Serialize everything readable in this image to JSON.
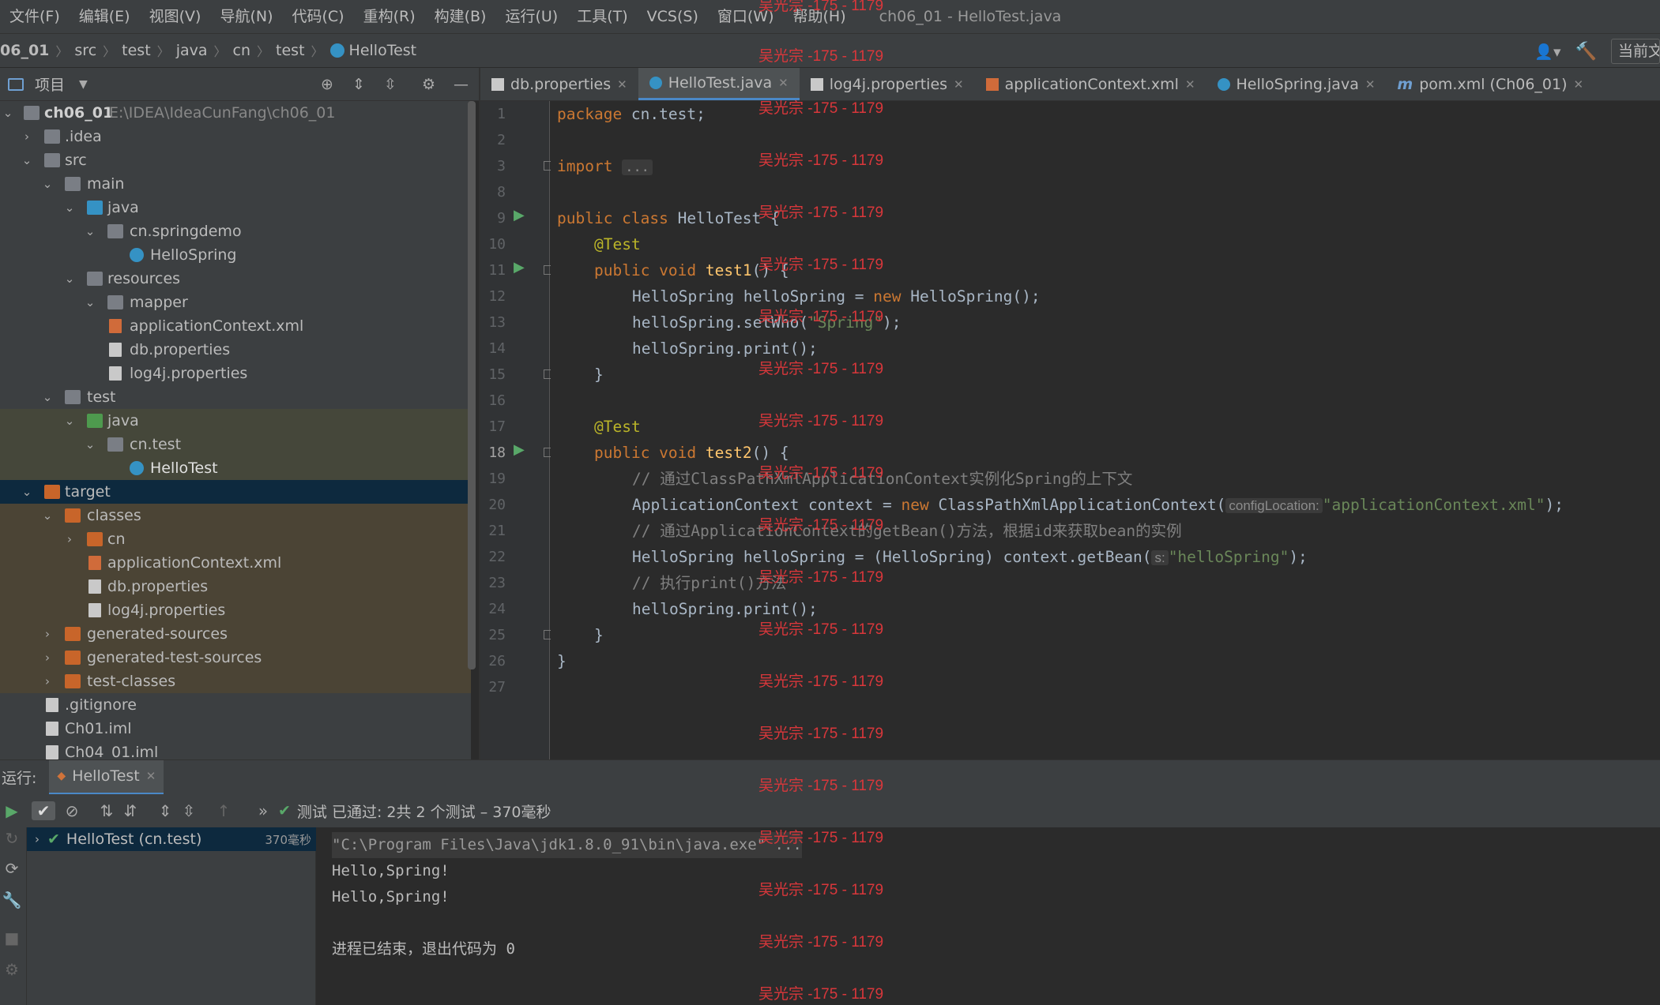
{
  "menu": {
    "items": [
      "文件(F)",
      "编辑(E)",
      "视图(V)",
      "导航(N)",
      "代码(C)",
      "重构(R)",
      "构建(B)",
      "运行(U)",
      "工具(T)",
      "VCS(S)",
      "窗口(W)",
      "帮助(H)"
    ],
    "window_title": "ch06_01 - HelloTest.java"
  },
  "breadcrumb": {
    "items": [
      "06_01",
      "src",
      "test",
      "java",
      "cn",
      "test",
      "HelloTest"
    ],
    "right_button": "当前文"
  },
  "project": {
    "title": "项目",
    "tree": [
      {
        "label": "ch06_01",
        "path": "E:\\IDEA\\IdeaCunFang\\ch06_01"
      },
      {
        "label": ".idea"
      },
      {
        "label": "src"
      },
      {
        "label": "main"
      },
      {
        "label": "java"
      },
      {
        "label": "cn.springdemo"
      },
      {
        "label": "HelloSpring"
      },
      {
        "label": "resources"
      },
      {
        "label": "mapper"
      },
      {
        "label": "applicationContext.xml"
      },
      {
        "label": "db.properties"
      },
      {
        "label": "log4j.properties"
      },
      {
        "label": "test"
      },
      {
        "label": "java"
      },
      {
        "label": "cn.test"
      },
      {
        "label": "HelloTest"
      },
      {
        "label": "target"
      },
      {
        "label": "classes"
      },
      {
        "label": "cn"
      },
      {
        "label": "applicationContext.xml"
      },
      {
        "label": "db.properties"
      },
      {
        "label": "log4j.properties"
      },
      {
        "label": "generated-sources"
      },
      {
        "label": "generated-test-sources"
      },
      {
        "label": "test-classes"
      },
      {
        "label": ".gitignore"
      },
      {
        "label": "Ch01.iml"
      },
      {
        "label": "Ch04_01.iml"
      }
    ]
  },
  "tabs": [
    {
      "label": "db.properties"
    },
    {
      "label": "HelloTest.java",
      "active": true
    },
    {
      "label": "log4j.properties"
    },
    {
      "label": "applicationContext.xml"
    },
    {
      "label": "HelloSpring.java"
    },
    {
      "label": "pom.xml (Ch06_01)"
    }
  ],
  "editor": {
    "line_numbers": [
      "1",
      "2",
      "3",
      "8",
      "9",
      "10",
      "11",
      "12",
      "13",
      "14",
      "15",
      "16",
      "17",
      "18",
      "19",
      "20",
      "21",
      "22",
      "23",
      "24",
      "25",
      "26",
      "27"
    ],
    "lines": {
      "l1a": "package",
      "l1b": " cn.test;",
      "l3a": "import",
      "l3b": "...",
      "l9a": "public class",
      "l9b": " HelloTest {",
      "l10": "@Test",
      "l11a": "public void",
      "l11b": "test1",
      "l11c": "() {",
      "l12a": "HelloSpring helloSpring = ",
      "l12b": "new",
      "l12c": " HelloSpring();",
      "l13a": "helloSpring.setWho(",
      "l13b": "\"Spring\"",
      "l13c": ");",
      "l14": "helloSpring.print();",
      "l15": "}",
      "l17": "@Test",
      "l18a": "public void",
      "l18b": "test2",
      "l18c": "() {",
      "l19": "// 通过ClassPathXmlApplicationContext实例化Spring的上下文",
      "l20a": "ApplicationContext context = ",
      "l20b": "new",
      "l20c": " ClassPathXmlApplicationContext(",
      "l20hint": "configLocation:",
      "l20d": "\"applicationContext.xml\"",
      "l20e": ");",
      "l21": "// 通过ApplicationContext的getBean()方法，根据id来获取bean的实例",
      "l22a": "HelloSpring helloSpring = (HelloSpring) context.getBean(",
      "l22hint": "s:",
      "l22b": "\"helloSpring\"",
      "l22c": ");",
      "l23": "// 执行print()方法",
      "l24": "helloSpring.print();",
      "l25": "}",
      "l26": "}"
    }
  },
  "run": {
    "label": "运行:",
    "tab": "HelloTest",
    "status": "测试 已通过: 2共 2 个测试 – 370毫秒",
    "test_item": "HelloTest (cn.test)",
    "test_time": "370毫秒",
    "console": [
      "\"C:\\Program Files\\Java\\jdk1.8.0_91\\bin\\java.exe\" ...",
      "Hello,Spring!",
      "Hello,Spring!",
      "",
      "进程已结束，退出代码为 0"
    ]
  },
  "watermark": "吴光宗 -175 - 1179",
  "colors": {
    "accent": "#4a88c7",
    "pass": "#59a869",
    "watermark": "#d9373b"
  }
}
